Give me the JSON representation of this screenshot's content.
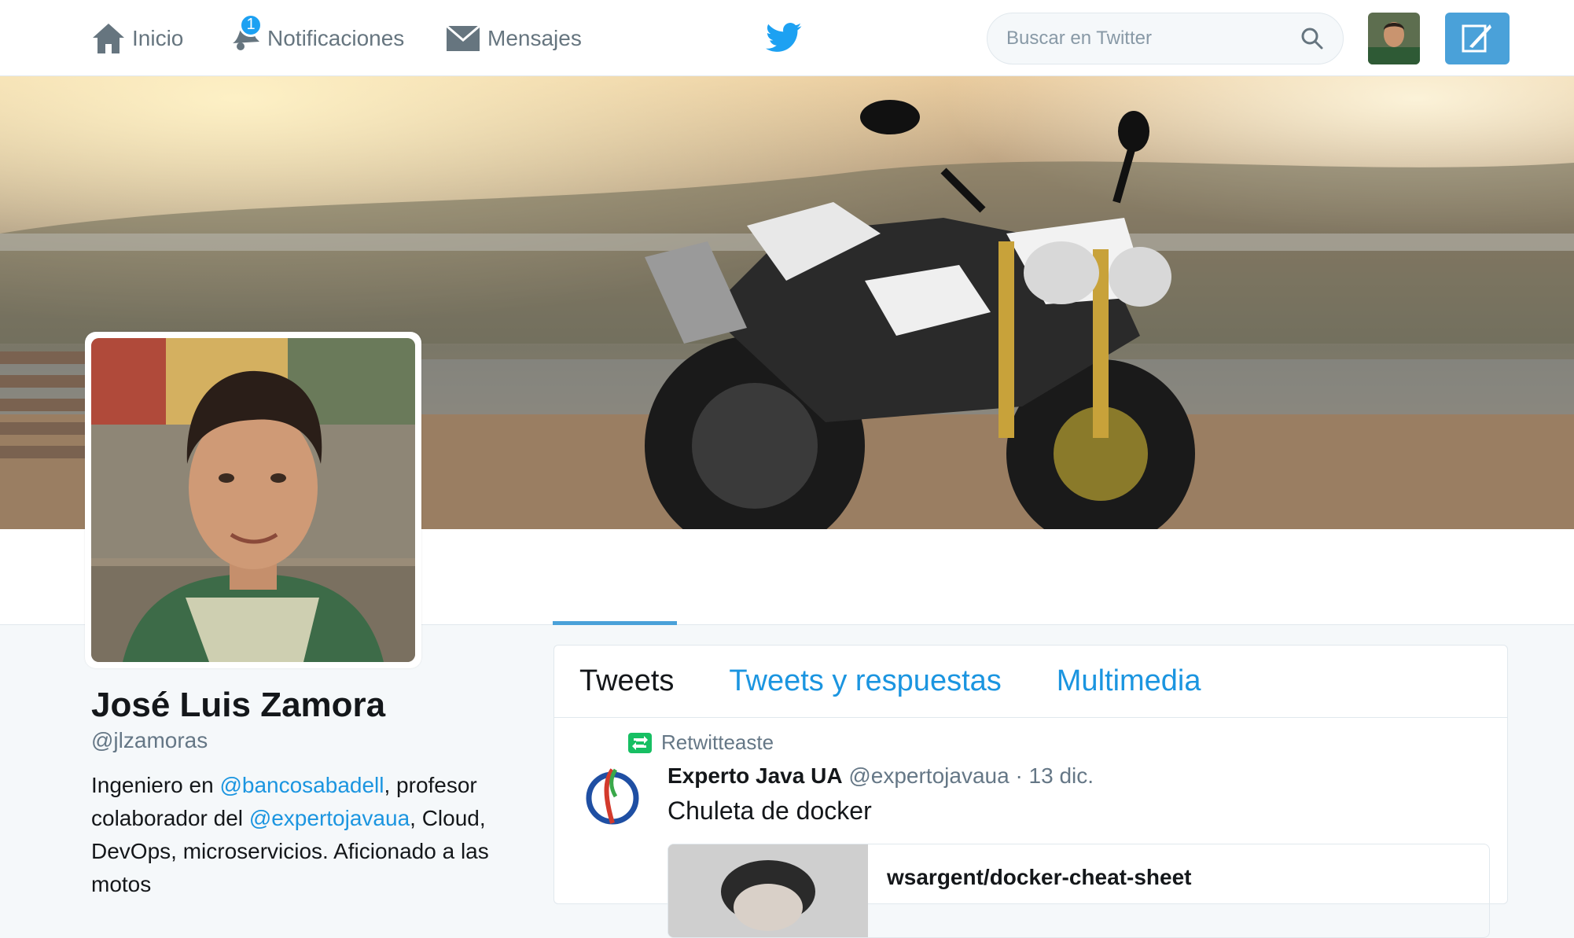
{
  "nav": {
    "home_label": "Inicio",
    "notifications_label": "Notificaciones",
    "notifications_badge": "1",
    "messages_label": "Mensajes"
  },
  "search": {
    "placeholder": "Buscar en Twitter"
  },
  "profile": {
    "name": "José Luis Zamora",
    "handle": "@jlzamoras",
    "bio_part1": "Ingeniero en ",
    "bio_link1": "@bancosabadell",
    "bio_part2": ", profesor colaborador del ",
    "bio_link2": "@expertojavaua",
    "bio_part3": ", Cloud, DevOps, microservicios. Aficionado a las motos"
  },
  "tabs": [
    {
      "label": "Tweets"
    },
    {
      "label": "Tweets y respuestas"
    },
    {
      "label": "Multimedia"
    }
  ],
  "tweet": {
    "retweet_label": "Retwitteaste",
    "author_name": "Experto Java UA",
    "author_handle": "@expertojavaua",
    "date": "· 13 dic.",
    "text": "Chuleta de docker",
    "card_title": "wsargent/docker-cheat-sheet"
  },
  "colors": {
    "accent": "#1da1f2",
    "link": "#1b95e0",
    "retweet": "#17bf63"
  }
}
